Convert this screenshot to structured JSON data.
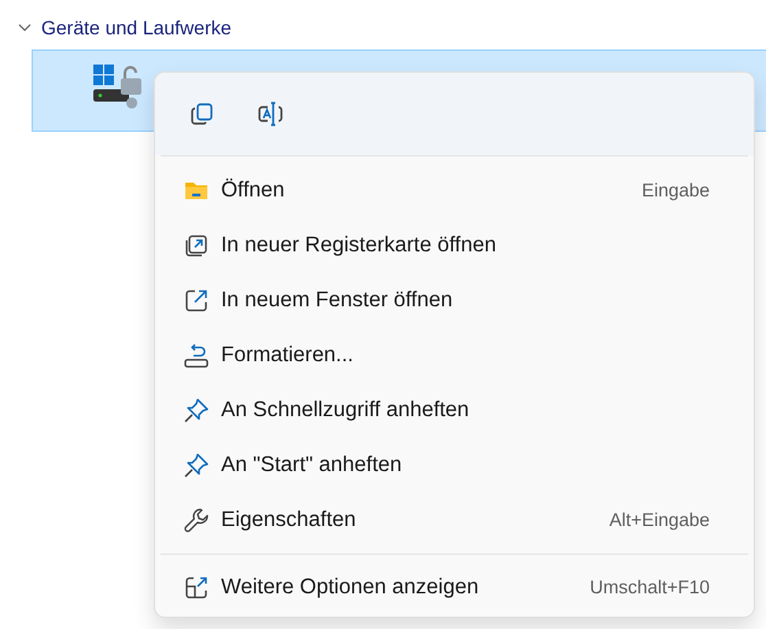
{
  "section": {
    "title": "Geräte und Laufwerke",
    "expanded": true
  },
  "drive": {
    "selected": true
  },
  "quick_actions": [
    {
      "kind": "copy"
    },
    {
      "kind": "rename"
    }
  ],
  "menu_items": [
    {
      "kind": "open",
      "label": "Öffnen",
      "shortcut": "Eingabe"
    },
    {
      "kind": "new-tab",
      "label": "In neuer Registerkarte öffnen"
    },
    {
      "kind": "new-window",
      "label": "In neuem Fenster öffnen"
    },
    {
      "kind": "format",
      "label": "Formatieren..."
    },
    {
      "kind": "pin",
      "label": "An Schnellzugriff anheften"
    },
    {
      "kind": "pin",
      "label": "An \"Start\" anheften"
    },
    {
      "kind": "properties",
      "label": "Eigenschaften",
      "shortcut": "Alt+Eingabe"
    },
    {
      "kind": "separator"
    },
    {
      "kind": "more",
      "label": "Weitere Optionen anzeigen",
      "shortcut": "Umschalt+F10"
    }
  ]
}
